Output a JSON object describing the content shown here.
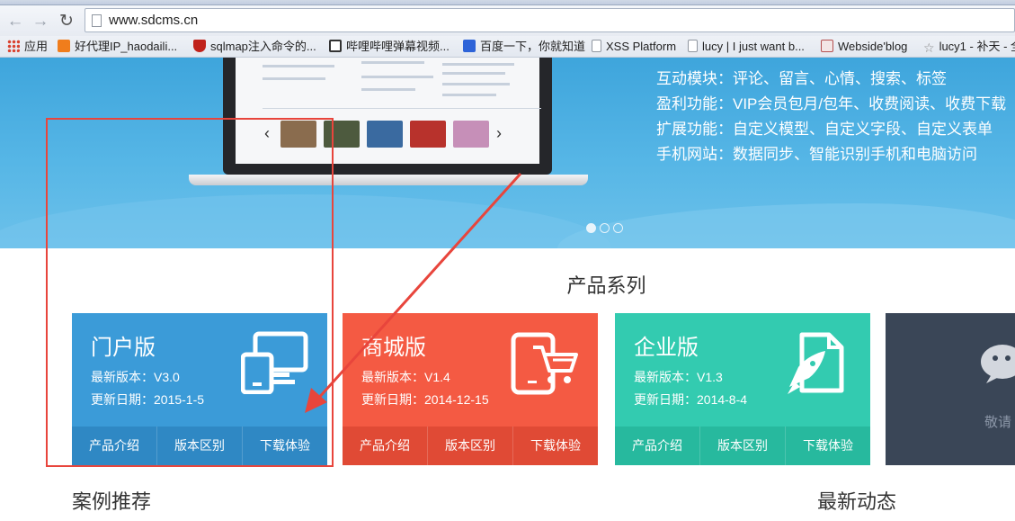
{
  "browser": {
    "url": "www.sdcms.cn",
    "bookmarks": [
      {
        "label": "应用",
        "icon": "apps-grid-icon",
        "color": "#d9412e"
      },
      {
        "label": "好代理IP_haodaili...",
        "icon": "ip-proxy-icon",
        "color": "#f07d1c"
      },
      {
        "label": "sqlmap注入命令的...",
        "icon": "shield-icon",
        "color": "#c0221b"
      },
      {
        "label": "哔哩哔哩弹幕视频...",
        "icon": "tv-icon",
        "color": "#333333"
      },
      {
        "label": "百度一下，你就知道",
        "icon": "paw-icon",
        "color": "#2d63d8"
      },
      {
        "label": "XSS Platform",
        "icon": "page-icon",
        "color": "#ffffff"
      },
      {
        "label": "lucy | I just want b...",
        "icon": "page-icon",
        "color": "#ffffff"
      },
      {
        "label": "Webside'blog",
        "icon": "blog-icon",
        "color": "#b45050"
      },
      {
        "label": "lucy1 - 补天 - 全",
        "icon": "star-icon",
        "color": "#888888"
      }
    ]
  },
  "banner": {
    "features": [
      "互动模块：评论、留言、心情、搜索、标签",
      "盈利功能：VIP会员包月/包年、收费阅读、收费下载",
      "扩展功能：自定义模型、自定义字段、自定义表单",
      "手机网站：数据同步、智能识别手机和电脑访问"
    ],
    "slide_count": 3,
    "active_slide": 1
  },
  "products": {
    "title": "产品系列",
    "cards": [
      {
        "name": "门户版",
        "version": "最新版本：V3.0",
        "date": "更新日期：2015-1-5",
        "buttons": [
          "产品介绍",
          "版本区别",
          "下载体验"
        ],
        "color": "#3b9bd8",
        "bar_color": "#2f88c4",
        "icon": "devices-icon"
      },
      {
        "name": "商城版",
        "version": "最新版本：V1.4",
        "date": "更新日期：2014-12-15",
        "buttons": [
          "产品介绍",
          "版本区别",
          "下载体验"
        ],
        "color": "#f45a43",
        "bar_color": "#e04a35",
        "icon": "shopping-cart-icon"
      },
      {
        "name": "企业版",
        "version": "最新版本：V1.3",
        "date": "更新日期：2014-8-4",
        "buttons": [
          "产品介绍",
          "版本区别",
          "下载体验"
        ],
        "color": "#33cbb0",
        "bar_color": "#27b99e",
        "icon": "rocket-icon"
      },
      {
        "name": "",
        "caption": "敬请",
        "color": "#3a4657",
        "icon": "wechat-icon"
      }
    ]
  },
  "footer": {
    "cases_title": "案例推荐",
    "news_title": "最新动态"
  }
}
